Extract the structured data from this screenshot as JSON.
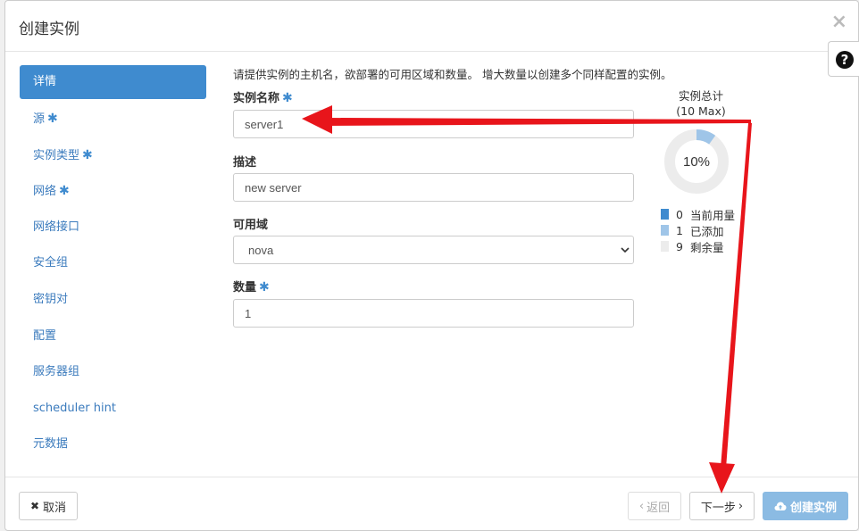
{
  "modal": {
    "title": "创建实例",
    "close": "×",
    "help": "?"
  },
  "nav": {
    "items": [
      {
        "label": "详情",
        "required": false,
        "active": true
      },
      {
        "label": "源",
        "required": true
      },
      {
        "label": "实例类型",
        "required": true
      },
      {
        "label": "网络",
        "required": true
      },
      {
        "label": "网络接口",
        "required": false
      },
      {
        "label": "安全组",
        "required": false
      },
      {
        "label": "密钥对",
        "required": false
      },
      {
        "label": "配置",
        "required": false
      },
      {
        "label": "服务器组",
        "required": false
      },
      {
        "label": "scheduler hint",
        "required": false
      },
      {
        "label": "元数据",
        "required": false
      }
    ],
    "required_mark": "✱"
  },
  "form": {
    "help_text": "请提供实例的主机名，欲部署的可用区域和数量。 增大数量以创建多个同样配置的实例。",
    "instance_name_label": "实例名称",
    "instance_name_value": "server1",
    "description_label": "描述",
    "description_value": "new server",
    "az_label": "可用域",
    "az_value": "nova",
    "count_label": "数量",
    "count_value": "1"
  },
  "quota": {
    "title": "实例总计",
    "max": "(10 Max)",
    "percent_label": "10%",
    "used_fraction": 0.0,
    "added_fraction": 0.1,
    "legend": [
      {
        "count": "0",
        "label": "当前用量",
        "color": "#3f8bcf"
      },
      {
        "count": "1",
        "label": "已添加",
        "color": "#9fc5e8"
      },
      {
        "count": "9",
        "label": "剩余量",
        "color": "#ececec"
      }
    ]
  },
  "footer": {
    "cancel": "取消",
    "back": "返回",
    "next": "下一步",
    "create": "创建实例"
  },
  "colors": {
    "accent": "#3f8bcf",
    "annotation_arrow": "#e8151b"
  }
}
